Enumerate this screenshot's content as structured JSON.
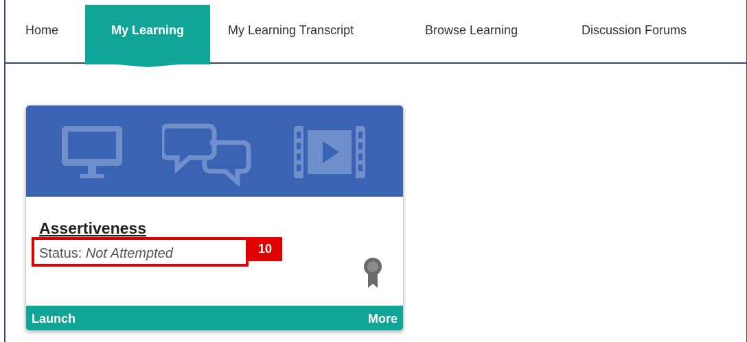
{
  "nav": {
    "items": [
      {
        "label": "Home"
      },
      {
        "label": "My Learning",
        "active": true
      },
      {
        "label": "My Learning Transcript"
      },
      {
        "label": "Browse Learning"
      },
      {
        "label": "Discussion Forums"
      }
    ]
  },
  "card": {
    "banner_icons": [
      "monitor-icon",
      "chat-bubbles-icon",
      "video-film-icon"
    ],
    "title": "Assertiveness",
    "status_label": "Status:",
    "status_value": "Not Attempted",
    "badge_icon": "award-ribbon-icon",
    "footer": {
      "launch_label": "Launch",
      "more_label": "More"
    }
  },
  "annotation": {
    "tag": "10"
  },
  "colors": {
    "accent": "#10a596",
    "banner": "#3a63b4",
    "highlight": "#e00000",
    "frame": "#2b4a80"
  }
}
